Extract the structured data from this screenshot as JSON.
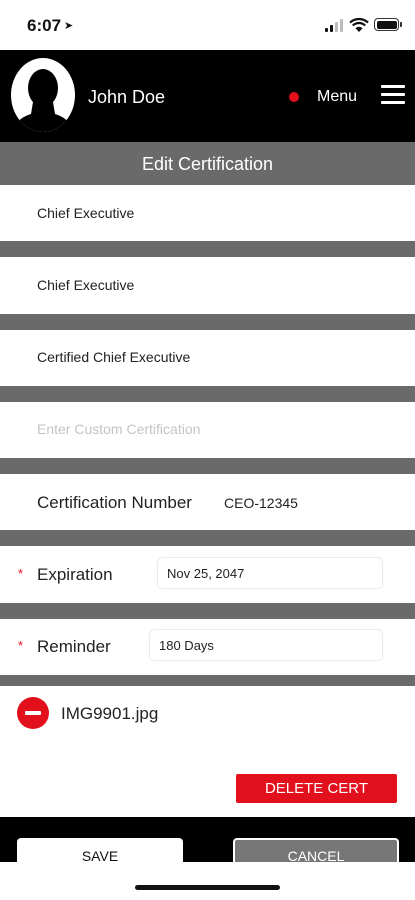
{
  "status_bar": {
    "time": "6:07",
    "icons": [
      "location-arrow-icon",
      "cellular-signal-icon",
      "wifi-icon",
      "battery-icon"
    ]
  },
  "header": {
    "user_name": "John Doe",
    "menu_label": "Menu",
    "status_dot_color": "#e2101d"
  },
  "title": "Edit Certification",
  "rows": {
    "category": "Chief Executive",
    "type": "Chief Executive",
    "certification": "Certified Chief Executive",
    "custom_placeholder": "Enter Custom Certification"
  },
  "cert_number": {
    "label": "Certification Number",
    "value": "CEO-12345"
  },
  "expiration": {
    "required_mark": "*",
    "label": "Expiration",
    "value": "Nov 25, 2047"
  },
  "reminder": {
    "required_mark": "*",
    "label": "Reminder",
    "value": "180 Days"
  },
  "attachment": {
    "file_name": "IMG9901.jpg"
  },
  "buttons": {
    "delete_cert": "DELETE CERT",
    "save": "SAVE",
    "cancel": "CANCEL"
  },
  "colors": {
    "accent_red": "#e2101d",
    "header_black": "#000000",
    "bar_gray": "#6a6a6a"
  }
}
